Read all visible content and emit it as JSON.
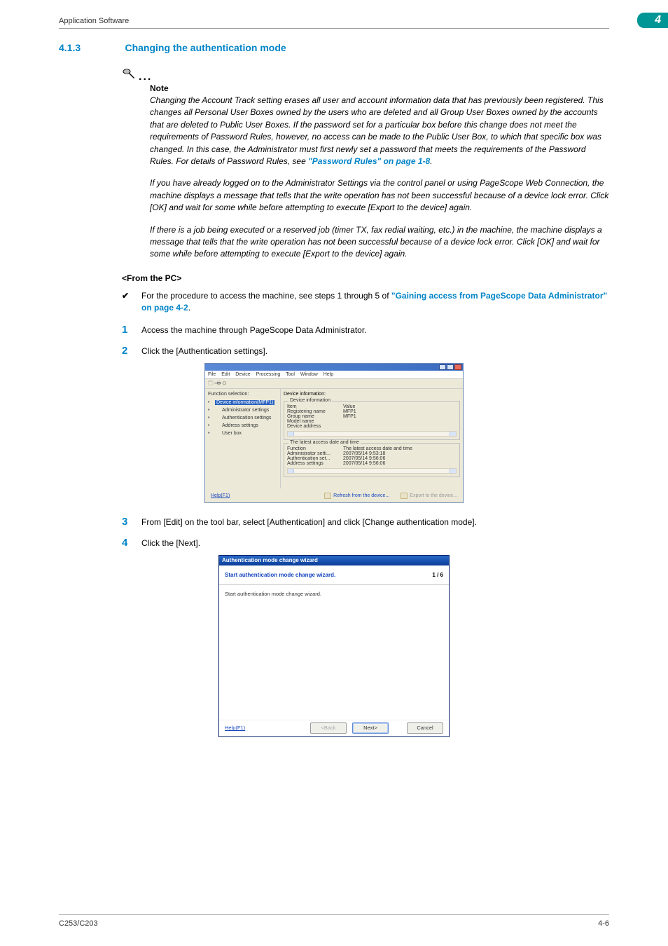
{
  "header": {
    "title": "Application Software"
  },
  "chapter": "4",
  "section": {
    "number": "4.1.3",
    "title": "Changing the authentication mode"
  },
  "note": {
    "label": "Note",
    "para1_a": "Changing the Account Track setting erases all user and account information data that has previously been registered. This changes all Personal User Boxes owned by the users who are deleted and all Group User Boxes owned by the accounts that are deleted to Public User Boxes. If the password set for a particular box before this change does not meet the requirements of Password Rules, however, no access can be made to the Public User Box, to which that specific box was changed. In this case, the Administrator must first newly set a password that meets the requirements of the Password Rules. For details of Password Rules, see ",
    "para1_link": "\"Password Rules\" on page 1-8",
    "para1_b": ".",
    "para2": "If you have already logged on to the Administrator Settings via the control panel or using PageScope Web Connection, the machine displays a message that tells that the write operation has not been successful because of a device lock error. Click [OK] and wait for some while before attempting to execute [Export to the device] again.",
    "para3": "If there is a job being executed or a reserved job (timer TX, fax redial waiting, etc.) in the machine, the machine displays a message that tells that the write operation has not been successful because of a device lock error. Click [OK] and wait for some while before attempting to execute [Export to the device] again."
  },
  "from_pc_label": "<From the PC>",
  "checkline": {
    "pre": "For the procedure to access the machine, see steps 1 through 5 of ",
    "link": "\"Gaining access from PageScope Data Administrator\" on page 4-2",
    "post": "."
  },
  "steps": {
    "s1": "Access the machine through PageScope Data Administrator.",
    "s2": "Click the [Authentication settings].",
    "s3": "From [Edit] on the tool bar, select [Authentication] and click [Change authentication mode].",
    "s4": "Click the [Next]."
  },
  "win1": {
    "menu": [
      "File",
      "Edit",
      "Device",
      "Processing",
      "Tool",
      "Window",
      "Help"
    ],
    "left_label": "Function selection:",
    "tree": {
      "root": "Device information(MFP1)",
      "items": [
        "Administrator settings",
        "Authentication settings",
        "Address settings",
        "User box"
      ]
    },
    "right_label": "Device information:",
    "group1": {
      "legend": "Device information",
      "headers": [
        "Item",
        "Value"
      ],
      "rows": [
        {
          "k": "Registering name",
          "v": "MFP1"
        },
        {
          "k": "Group name",
          "v": "MFP1"
        },
        {
          "k": "Model name",
          "v": ""
        },
        {
          "k": "Device address",
          "v": ""
        }
      ]
    },
    "group2": {
      "legend": "The latest access date and time",
      "headers": [
        "Function",
        "The latest access date and time"
      ],
      "rows": [
        {
          "k": "Administrator setti...",
          "v": "2007/05/14 9:53:18"
        },
        {
          "k": "Authentication set...",
          "v": "2007/05/14 9:56:06"
        },
        {
          "k": "Address settings",
          "v": "2007/05/14 9:56:06"
        }
      ]
    },
    "footer": {
      "help": "Help(F1)",
      "refresh": "Refresh from the device...",
      "export": "Export to the device..."
    }
  },
  "win2": {
    "title": "Authentication mode change wizard",
    "head": "Start authentication mode change wizard.",
    "page": "1 / 6",
    "body": "Start authentication mode change wizard.",
    "footer": {
      "help": "Help(F1)",
      "back": "<Back",
      "next": "Next>",
      "cancel": "Cancel"
    }
  },
  "footer": {
    "left": "C253/C203",
    "right": "4-6"
  }
}
